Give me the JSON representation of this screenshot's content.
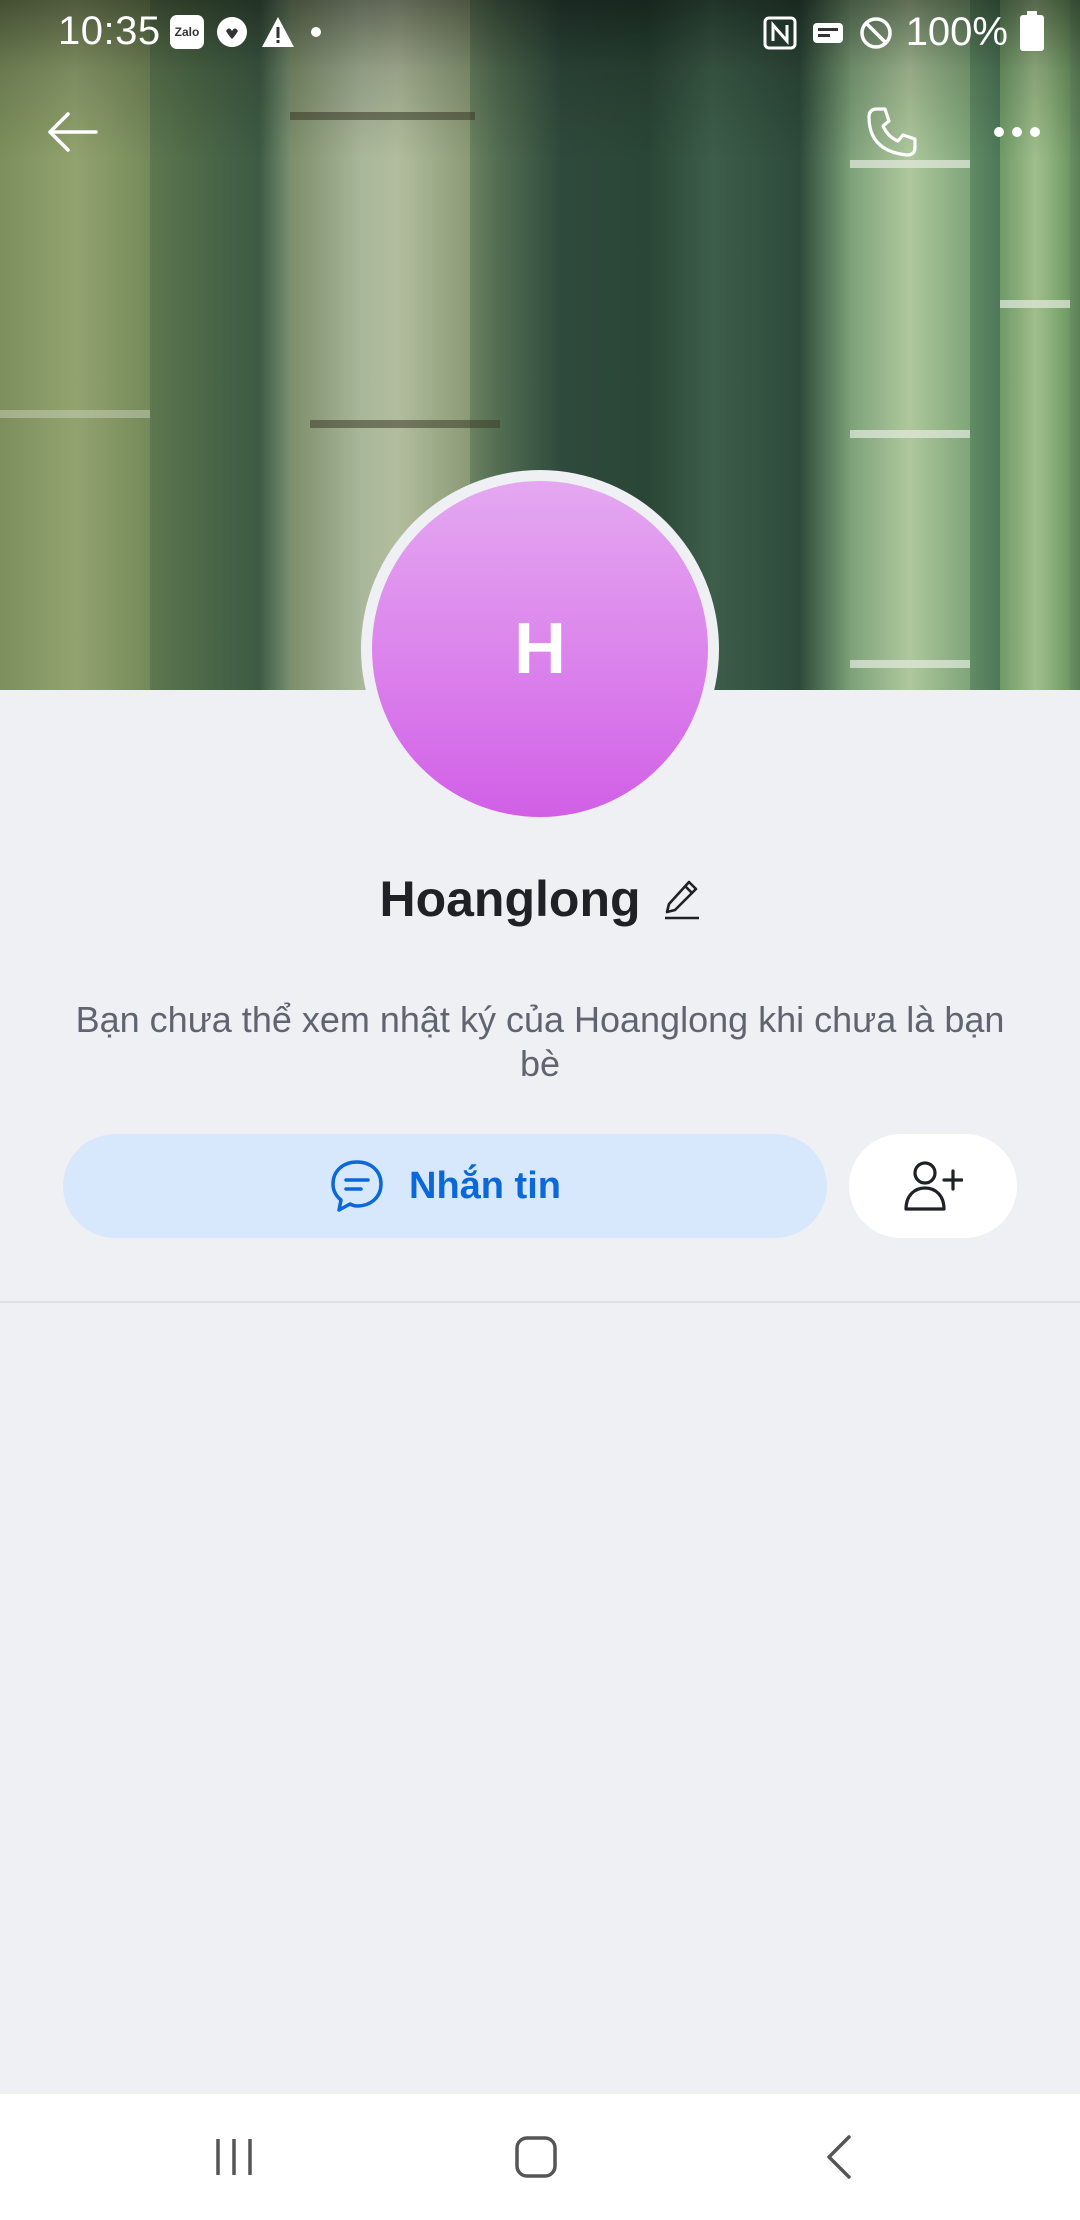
{
  "status_bar": {
    "time": "10:35",
    "left_icons": [
      "zalo-notification-icon",
      "sync-heart-icon",
      "warning-icon",
      "dot-icon"
    ],
    "zalo_badge": "Zalo",
    "right_icons": [
      "nfc-icon",
      "wallet-icon",
      "do-not-disturb-icon",
      "battery-icon"
    ],
    "battery": "100%"
  },
  "header": {
    "back_icon": "arrow-left-icon",
    "call_icon": "phone-icon",
    "more_icon": "more-horizontal-icon"
  },
  "profile": {
    "avatar_letter": "H",
    "avatar_colors": [
      "#e4a8f0",
      "#d15fe6"
    ],
    "name": "Hoanglong",
    "edit_icon": "pencil-icon",
    "notice": "Bạn chưa thể xem nhật ký của Hoanglong khi chưa là bạn bè"
  },
  "actions": {
    "message_label": "Nhắn tin",
    "message_icon": "chat-bubble-icon",
    "add_friend_icon": "add-user-icon",
    "accent_color": "#0a68d8"
  },
  "nav_bar": {
    "recents_icon": "recents-icon",
    "home_icon": "home-icon",
    "back_icon": "back-chevron-icon"
  }
}
